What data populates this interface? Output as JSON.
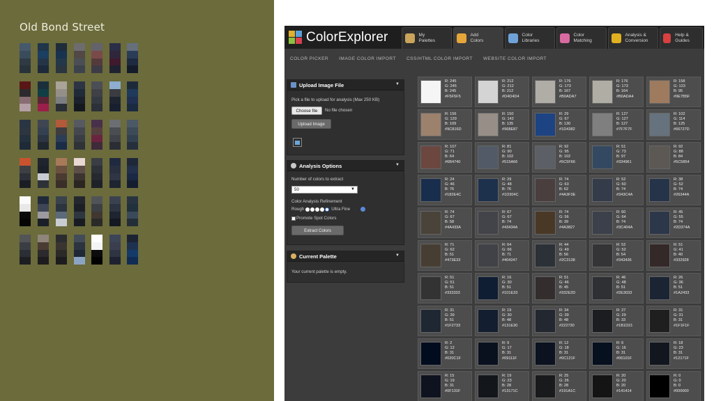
{
  "left_panel": {
    "title": "Old Bond Street",
    "palette_rows": [
      [
        [
          "#46596b",
          "#3a4c5c",
          "#2f3a44",
          "#27323a"
        ],
        [
          "#203549",
          "#1b3f60",
          "#253548",
          "#1c2a3a"
        ],
        [
          "#1f2c3a",
          "#17334f",
          "#24384a",
          "#2a3540"
        ],
        [
          "#6e6c6e",
          "#524845",
          "#4b4f55",
          "#3c434c"
        ],
        [
          "#64626a",
          "#7a4a4a",
          "#553a3c",
          "#3d3b45"
        ],
        [
          "#2b2e47",
          "#30263c",
          "#3f1a2c",
          "#1e2230"
        ],
        [
          "#65707c",
          "#2b3c57",
          "#1e2a40",
          "#141c2b"
        ]
      ],
      [
        [
          "#5a1616",
          "#2c2a2e",
          "#8a6d74",
          "#b49fa6"
        ],
        [
          "#1b2f3a",
          "#113e44",
          "#5b2535",
          "#9a1f4a"
        ],
        [
          "#a9a398",
          "#948f88",
          "#7d7e82",
          "#2a2e36"
        ],
        [
          "#2d3544",
          "#202a38",
          "#1a202c",
          "#131820"
        ],
        [
          "#4c4e55",
          "#3f4147",
          "#353a42",
          "#2c3038"
        ],
        [
          "#8eaed0",
          "#3a3c42",
          "#1f2530",
          "#182030"
        ],
        [
          "#1d2a3a",
          "#1f3a5a",
          "#203050",
          "#1a2a40"
        ]
      ],
      [
        [
          "#2a3544",
          "#2c3540",
          "#24303e",
          "#1e2a38"
        ],
        [
          "#3f4652",
          "#354150",
          "#2c3542",
          "#21272f"
        ],
        [
          "#b35a3a",
          "#3f3c40",
          "#2b3d55",
          "#1a2c48"
        ],
        [
          "#565a60",
          "#44484e",
          "#3a3e44",
          "#2f3338"
        ],
        [
          "#49304a",
          "#56403f",
          "#6b2440",
          "#3f2a3a"
        ],
        [
          "#6b6f73",
          "#4a4e52",
          "#3f4348",
          "#2a2e34"
        ],
        [
          "#4b5866",
          "#3d4a58",
          "#324050",
          "#26303c"
        ]
      ],
      [
        [
          "#c9532e",
          "#3d3f44",
          "#2c3038",
          "#1a1e24"
        ],
        [
          "#20242c",
          "#1c2028",
          "#c8ccd2",
          "#2e3238"
        ],
        [
          "#a87a5a",
          "#6a503e",
          "#4a3a32",
          "#3a2e28"
        ],
        [
          "#ead8d4",
          "#5e4e48",
          "#3c3430",
          "#2c2622"
        ],
        [
          "#3a3e44",
          "#2e3238",
          "#262a30",
          "#1e2228"
        ],
        [
          "#1f2a40",
          "#283040",
          "#2f3544",
          "#1e2430"
        ],
        [
          "#1e2838",
          "#22304a",
          "#1a2844",
          "#141e30"
        ]
      ],
      [
        [
          "#fafafa",
          "#e8e8e8",
          "#0a0a0a",
          "#050505"
        ],
        [
          "#202a3a",
          "#3e4656",
          "#9c9aa0",
          "#1a1f28"
        ],
        [
          "#3a424c",
          "#2c3440",
          "#5c6a7a",
          "#c8cdd2"
        ],
        [
          "#24282e",
          "#1c2026",
          "#2e3640",
          "#181c22"
        ],
        [
          "#505458",
          "#3c4044",
          "#403830",
          "#2c2a28"
        ],
        [
          "#3a4250",
          "#2c3440",
          "#1e2430",
          "#141820"
        ],
        [
          "#283440",
          "#20303c",
          "#3a4a5a",
          "#242e38"
        ]
      ],
      [
        [
          "#535455",
          "#3a3e44",
          "#2b2e34",
          "#1c1e22"
        ],
        [
          "#8f857a",
          "#4a3c34",
          "#2c2a2c",
          "#1e1c1e"
        ],
        [
          "#2a2c30",
          "#3a3430",
          "#2c2a28",
          "#1c1c1e"
        ],
        [
          "#424c58",
          "#2c3440",
          "#1e2836",
          "#8ca4c4"
        ],
        [
          "#ffffff",
          "#f4f4f4",
          "#0c0c0c",
          "#020202"
        ],
        [
          "#3c4458",
          "#3a3e4e",
          "#2e3442",
          "#1e2230"
        ],
        [
          "#1c2434",
          "#1e3250",
          "#143a6a",
          "#102c54"
        ]
      ]
    ]
  },
  "app": {
    "logo_text": "ColorExplorer",
    "tabs": [
      {
        "label": "My\nPalettes",
        "icon": "palette-icon",
        "color": "#c9a45a"
      },
      {
        "label": "Add\nColors",
        "icon": "brush-icon",
        "color": "#e7a63a"
      },
      {
        "label": "Color\nLibraries",
        "icon": "book-icon",
        "color": "#6fa3d8"
      },
      {
        "label": "Color\nMatching",
        "icon": "color-wheel-icon",
        "color": "#d86aa0"
      },
      {
        "label": "Analysis &\nConversion",
        "icon": "exchange-icon",
        "color": "#e0b020"
      },
      {
        "label": "Help &\nGuides",
        "icon": "lifebuoy-icon",
        "color": "#d94040"
      }
    ],
    "subnav": [
      "COLOR PICKER",
      "IMAGE COLOR IMPORT",
      "CSS/HTML COLOR IMPORT",
      "WEBSITE COLOR IMPORT"
    ],
    "upload_panel": {
      "title": "Upload Image File",
      "instructions": "Pick a file to upload for analysis (Max 250 KB)",
      "choose_file_label": "Choose file",
      "no_file_text": "No file chosen",
      "upload_button": "Upload Image"
    },
    "analysis_panel": {
      "title": "Analysis Options",
      "num_colors_label": "Number of colors to extract",
      "num_colors_value": "50",
      "refinement_label": "Color Analysis Refinement",
      "refinement_min": "Rough",
      "refinement_max": "Ultra Fine",
      "promote_label": "Promote Spot Colors",
      "extract_button": "Extract Colors"
    },
    "current_palette": {
      "title": "Current Palette",
      "empty_text": "Your current palette is empty."
    }
  },
  "swatches": [
    {
      "r": 245,
      "g": 245,
      "b": 245,
      "hex": "#F5F5F5"
    },
    {
      "r": 212,
      "g": 212,
      "b": 212,
      "hex": "#D4D4D4"
    },
    {
      "r": 176,
      "g": 173,
      "b": 167,
      "hex": "#B0ADA7"
    },
    {
      "r": 176,
      "g": 173,
      "b": 164,
      "hex": "#B0ADA4"
    },
    {
      "r": 158,
      "g": 123,
      "b": 95,
      "hex": "#9E7B5F"
    },
    {
      "r": 156,
      "g": 129,
      "b": 109,
      "hex": "#9C816D"
    },
    {
      "r": 150,
      "g": 142,
      "b": 135,
      "hex": "#968E87"
    },
    {
      "r": 29,
      "g": 67,
      "b": 130,
      "hex": "#1D4382"
    },
    {
      "r": 127,
      "g": 127,
      "b": 127,
      "hex": "#7F7F7F"
    },
    {
      "r": 102,
      "g": 114,
      "b": 125,
      "hex": "#66727D"
    },
    {
      "r": 107,
      "g": 71,
      "b": 64,
      "hex": "#6B4740"
    },
    {
      "r": 81,
      "g": 90,
      "b": 102,
      "hex": "#515A66"
    },
    {
      "r": 92,
      "g": 95,
      "b": 102,
      "hex": "#5C5F66"
    },
    {
      "r": 51,
      "g": 73,
      "b": 97,
      "hex": "#334961"
    },
    {
      "r": 92,
      "g": 88,
      "b": 84,
      "hex": "#5C5854"
    },
    {
      "r": 24,
      "g": 46,
      "b": 76,
      "hex": "#182E4C"
    },
    {
      "r": 29,
      "g": 48,
      "b": 76,
      "hex": "#1D304C"
    },
    {
      "r": 74,
      "g": 63,
      "b": 62,
      "hex": "#4A3F3E"
    },
    {
      "r": 52,
      "g": 60,
      "b": 74,
      "hex": "#343C4A"
    },
    {
      "r": 38,
      "g": 52,
      "b": 74,
      "hex": "#26344A"
    },
    {
      "r": 74,
      "g": 67,
      "b": 58,
      "hex": "#4A433A"
    },
    {
      "r": 67,
      "g": 67,
      "b": 74,
      "hex": "#43434A"
    },
    {
      "r": 74,
      "g": 56,
      "b": 39,
      "hex": "#4A3827"
    },
    {
      "r": 60,
      "g": 64,
      "b": 74,
      "hex": "#3C404A"
    },
    {
      "r": 45,
      "g": 55,
      "b": 74,
      "hex": "#2D374A"
    },
    {
      "r": 71,
      "g": 62,
      "b": 51,
      "hex": "#473E33"
    },
    {
      "r": 64,
      "g": 66,
      "b": 71,
      "hex": "#404247"
    },
    {
      "r": 44,
      "g": 49,
      "b": 56,
      "hex": "#2C3138"
    },
    {
      "r": 52,
      "g": 52,
      "b": 54,
      "hex": "#343436"
    },
    {
      "r": 51,
      "g": 41,
      "b": 40,
      "hex": "#332928"
    },
    {
      "r": 51,
      "g": 51,
      "b": 51,
      "hex": "#333333"
    },
    {
      "r": 16,
      "g": 30,
      "b": 51,
      "hex": "#101E33"
    },
    {
      "r": 51,
      "g": 46,
      "b": 45,
      "hex": "#332E2D"
    },
    {
      "r": 46,
      "g": 48,
      "b": 51,
      "hex": "#2E3033"
    },
    {
      "r": 26,
      "g": 36,
      "b": 51,
      "hex": "#1A2433"
    },
    {
      "r": 31,
      "g": 39,
      "b": 51,
      "hex": "#1F2733"
    },
    {
      "r": 19,
      "g": 30,
      "b": 48,
      "hex": "#131E30"
    },
    {
      "r": 34,
      "g": 39,
      "b": 48,
      "hex": "#222730"
    },
    {
      "r": 27,
      "g": 29,
      "b": 33,
      "hex": "#1B1D21"
    },
    {
      "r": 31,
      "g": 31,
      "b": 31,
      "hex": "#1F1F1F"
    },
    {
      "r": 2,
      "g": 12,
      "b": 31,
      "hex": "#020C1F"
    },
    {
      "r": 9,
      "g": 17,
      "b": 31,
      "hex": "#09111F"
    },
    {
      "r": 12,
      "g": 18,
      "b": 31,
      "hex": "#0C121F"
    },
    {
      "r": 6,
      "g": 16,
      "b": 31,
      "hex": "#06101F"
    },
    {
      "r": 18,
      "g": 23,
      "b": 31,
      "hex": "#12171F"
    },
    {
      "r": 15,
      "g": 19,
      "b": 31,
      "hex": "#0F131F"
    },
    {
      "r": 19,
      "g": 23,
      "b": 28,
      "hex": "#13171C"
    },
    {
      "r": 25,
      "g": 26,
      "b": 28,
      "hex": "#191A1C"
    },
    {
      "r": 20,
      "g": 20,
      "b": 20,
      "hex": "#141414"
    },
    {
      "r": 0,
      "g": 0,
      "b": 0,
      "hex": "#000000"
    }
  ]
}
